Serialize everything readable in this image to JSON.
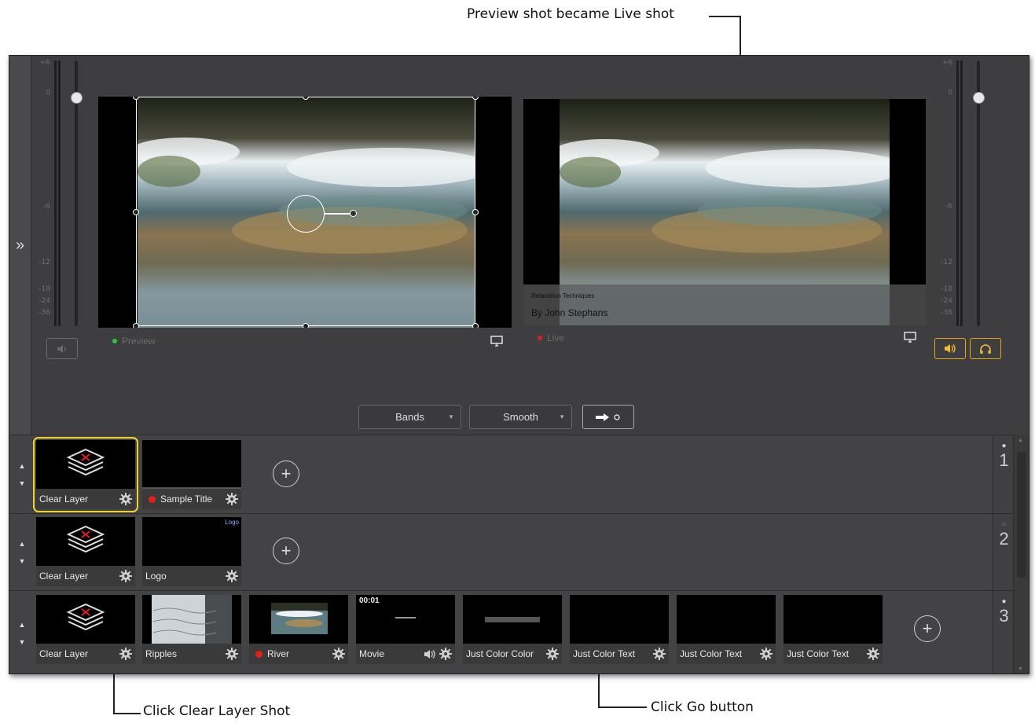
{
  "callouts": {
    "top": "Preview shot became Live shot",
    "clear_layer": "Click Clear Layer Shot",
    "go": "Click Go button"
  },
  "sidebar": {
    "toggle_icon": "double-chevron-right-icon",
    "glyph": "»"
  },
  "meters": {
    "ticks": [
      "+6",
      "0",
      "-6",
      "-12",
      "-18",
      "-24",
      "-36"
    ]
  },
  "preview": {
    "status_label": "Preview",
    "status_color": "#27c93f"
  },
  "live": {
    "status_label": "Live",
    "status_color": "#e0201c",
    "lower_third_title": "Relaxation Techniques",
    "lower_third_name": "By John Stephans"
  },
  "transition": {
    "type": "Bands",
    "easing": "Smooth",
    "go_icon": "arrow-right-icon"
  },
  "audio": {
    "speaker_icon": "speaker-icon",
    "headphones_icon": "headphones-icon"
  },
  "layers": [
    {
      "number": "1",
      "shots": [
        {
          "label": "Clear Layer",
          "icon": "layers-icon",
          "selected": true
        },
        {
          "label": "Sample Title",
          "live": true
        }
      ]
    },
    {
      "number": "2",
      "shots": [
        {
          "label": "Clear Layer",
          "icon": "layers-icon"
        },
        {
          "label": "Logo",
          "thumb_text": "Logo"
        }
      ]
    },
    {
      "number": "3",
      "shots": [
        {
          "label": "Clear Layer",
          "icon": "layers-icon"
        },
        {
          "label": "Ripples"
        },
        {
          "label": "River",
          "live": true
        },
        {
          "label": "Movie",
          "thumb_text": "00:01"
        },
        {
          "label": "Just Color Color"
        },
        {
          "label": "Just Color Text"
        },
        {
          "label": "Just Color Text"
        },
        {
          "label": "Just Color Text"
        }
      ]
    }
  ]
}
